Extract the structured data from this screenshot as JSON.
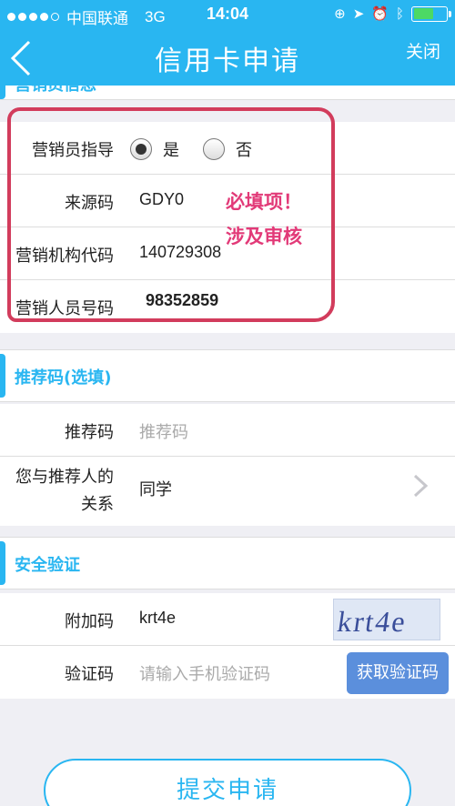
{
  "status_bar": {
    "carrier": "中国联通",
    "network": "3G",
    "time": "14:04",
    "colors": {
      "background": "#29b6f1",
      "battery": "#4cd964"
    }
  },
  "nav": {
    "back_icon": "chevron-left-icon",
    "title": "信用卡申请",
    "close_label": "关闭"
  },
  "marketing": {
    "section_title": "营销员信息",
    "guide_label": "营销员指导",
    "guide_yes": "是",
    "guide_no": "否",
    "guide_selected": "是",
    "source_code_label": "来源码",
    "source_code_value": "GDY0",
    "org_code_label": "营销机构代码",
    "org_code_value": "140729308",
    "staff_no_label": "营销人员号码",
    "staff_no_value": "98352859",
    "annotation_line1": "必填项！",
    "annotation_line2": "涉及审核",
    "annotation_color": "#e23a78"
  },
  "referral": {
    "section_title": "推荐码(选填)",
    "code_label": "推荐码",
    "code_placeholder": "推荐码",
    "relation_label_line1": "您与推荐人的",
    "relation_label_line2": "关系",
    "relation_value": "同学"
  },
  "security": {
    "section_title": "安全验证",
    "extra_code_label": "附加码",
    "extra_code_value": "krt4e",
    "captcha_text": "krt4e",
    "verify_label": "验证码",
    "verify_placeholder": "请输入手机验证码",
    "get_code_button": "获取验证码"
  },
  "submit_label": "提交申请",
  "accent_color": "#29b6f1"
}
